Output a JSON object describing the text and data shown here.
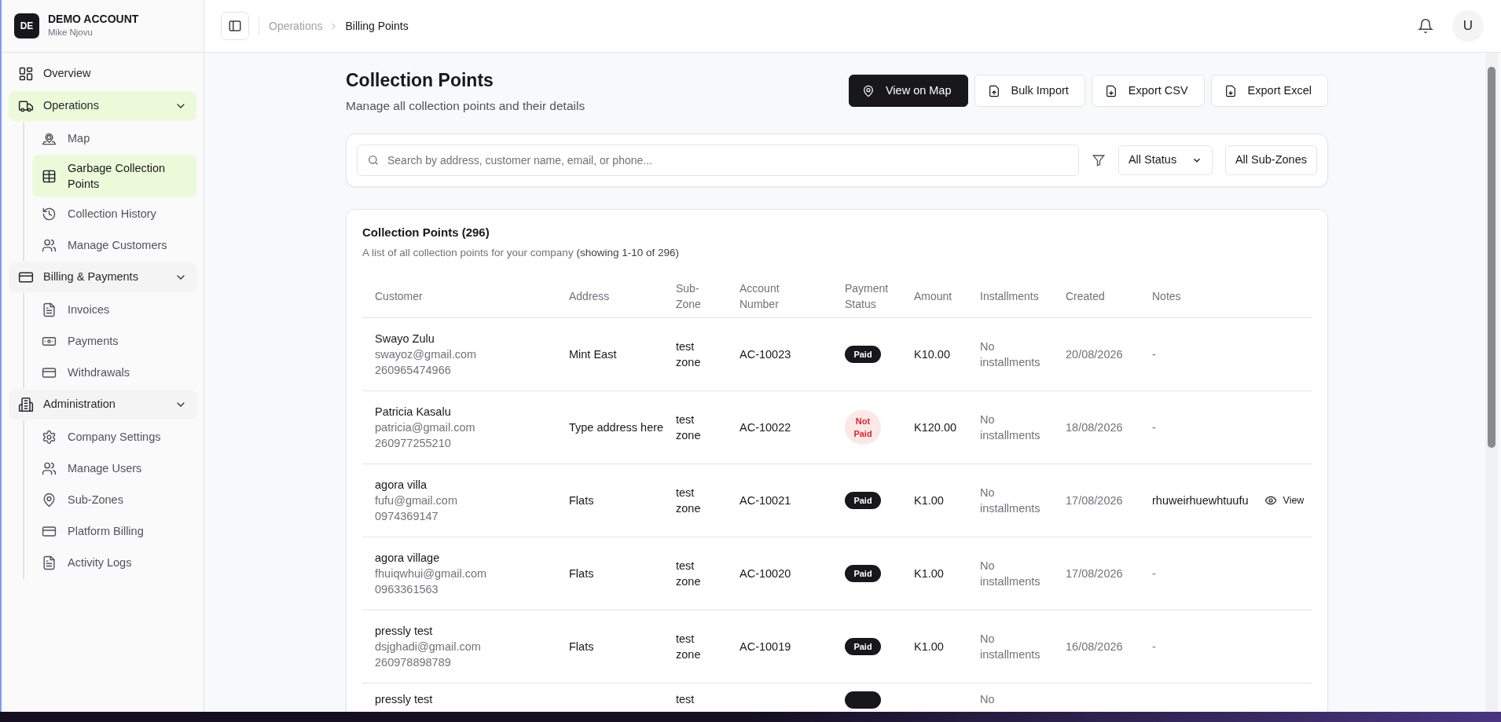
{
  "account": {
    "initials": "DE",
    "name": "DEMO ACCOUNT",
    "user": "Mike Njovu"
  },
  "sidebar": {
    "items": [
      {
        "label": "Overview",
        "selected": false
      },
      {
        "label": "Operations",
        "selected": true,
        "expanded": true,
        "children": [
          {
            "label": "Map",
            "selected": false
          },
          {
            "label": "Garbage Collection Points",
            "selected": true
          },
          {
            "label": "Collection History",
            "selected": false
          },
          {
            "label": "Manage Customers",
            "selected": false
          }
        ]
      },
      {
        "label": "Billing & Payments",
        "selected": false,
        "expanded": true,
        "children": [
          {
            "label": "Invoices",
            "selected": false
          },
          {
            "label": "Payments",
            "selected": false
          },
          {
            "label": "Withdrawals",
            "selected": false
          }
        ]
      },
      {
        "label": "Administration",
        "selected": false,
        "expanded": true,
        "children": [
          {
            "label": "Company Settings",
            "selected": false
          },
          {
            "label": "Manage Users",
            "selected": false
          },
          {
            "label": "Sub-Zones",
            "selected": false
          },
          {
            "label": "Platform Billing",
            "selected": false
          },
          {
            "label": "Activity Logs",
            "selected": false
          }
        ]
      }
    ]
  },
  "header": {
    "breadcrumb": [
      "Operations",
      "Billing Points"
    ],
    "avatar": "U"
  },
  "page": {
    "title": "Collection Points",
    "subtitle": "Manage all collection points and their details",
    "buttons": [
      {
        "label": "View on Map",
        "kind": "primary"
      },
      {
        "label": "Bulk Import",
        "kind": "outline"
      },
      {
        "label": "Export CSV",
        "kind": "outline"
      },
      {
        "label": "Export Excel",
        "kind": "outline"
      }
    ]
  },
  "filters": {
    "search_placeholder": "Search by address, customer name, email, or phone...",
    "status": "All Status",
    "sub_zone": "All Sub-Zones"
  },
  "table": {
    "title": "Collection Points (296)",
    "description": "A list of all collection points for your company",
    "range": "(showing 1-10 of 296)",
    "columns": [
      "Customer",
      "Address",
      "Sub-Zone",
      "Account Number",
      "Payment Status",
      "Amount",
      "Installments",
      "Created",
      "Notes"
    ],
    "rows": [
      {
        "name": "Swayo Zulu",
        "email": "swayoz@gmail.com",
        "phone": "260965474966",
        "address": "Mint East",
        "sub_zone": "test zone",
        "account": "AC-10023",
        "payment_status": "Paid",
        "paid": true,
        "amount": "K10.00",
        "installments": "No installments",
        "created": "20/08/2026",
        "notes": "-"
      },
      {
        "name": "Patricia Kasalu",
        "email": "patricia@gmail.com",
        "phone": "260977255210",
        "address": "Type address here",
        "sub_zone": "test zone",
        "account": "AC-10022",
        "payment_status": "Not Paid",
        "paid": false,
        "amount": "K120.00",
        "installments": "No installments",
        "created": "18/08/2026",
        "notes": "-"
      },
      {
        "name": "agora villa",
        "email": "fufu@gmail.com",
        "phone": "0974369147",
        "address": "Flats",
        "sub_zone": "test zone",
        "account": "AC-10021",
        "payment_status": "Paid",
        "paid": true,
        "amount": "K1.00",
        "installments": "No installments",
        "created": "17/08/2026",
        "notes": "rhuweirhuewhtuufu",
        "note_action": "View"
      },
      {
        "name": "agora village",
        "email": "fhuiqwhui@gmail.com",
        "phone": "0963361563",
        "address": "Flats",
        "sub_zone": "test zone",
        "account": "AC-10020",
        "payment_status": "Paid",
        "paid": true,
        "amount": "K1.00",
        "installments": "No installments",
        "created": "17/08/2026",
        "notes": "-"
      },
      {
        "name": "pressly test",
        "email": "dsjghadi@gmail.com",
        "phone": "260978898789",
        "address": "Flats",
        "sub_zone": "test zone",
        "account": "AC-10019",
        "payment_status": "Paid",
        "paid": true,
        "amount": "K1.00",
        "installments": "No installments",
        "created": "16/08/2026",
        "notes": "-"
      },
      {
        "name": "pressly test",
        "sub_zone": "test",
        "paid": true,
        "installments": "No"
      }
    ]
  }
}
